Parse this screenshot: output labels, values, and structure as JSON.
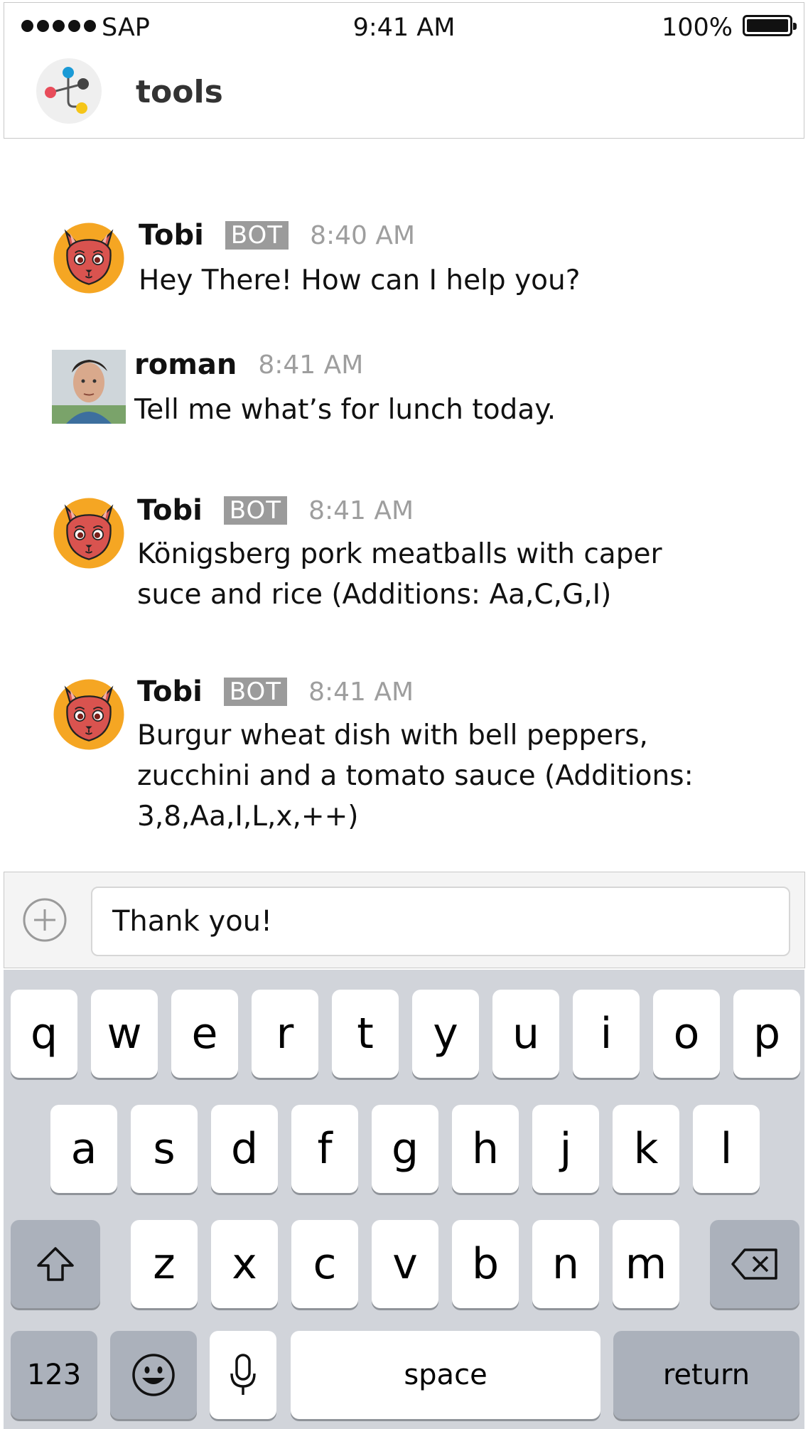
{
  "status_bar": {
    "carrier": "SAP",
    "time": "9:41 AM",
    "battery": "100%"
  },
  "channel": {
    "name": "tools"
  },
  "messages": [
    {
      "author": "Tobi",
      "badge": "BOT",
      "time": "8:40 AM",
      "text": "Hey There! How can I help you?"
    },
    {
      "author": "roman",
      "time": "8:41 AM",
      "text": "Tell me what’s for lunch today."
    },
    {
      "author": "Tobi",
      "badge": "BOT",
      "time": "8:41 AM",
      "text": "Königsberg pork meatballs with caper suce and rice (Additions: Aa,C,G,I)"
    },
    {
      "author": "Tobi",
      "badge": "BOT",
      "time": "8:41 AM",
      "text": "Burgur wheat dish with bell peppers, zucchini and a tomato sauce (Additions: 3,8,Aa,I,L,x,++)"
    }
  ],
  "composer": {
    "value": "Thank you!"
  },
  "keyboard": {
    "row1": [
      "q",
      "w",
      "e",
      "r",
      "t",
      "y",
      "u",
      "i",
      "o",
      "p"
    ],
    "row2": [
      "a",
      "s",
      "d",
      "f",
      "g",
      "h",
      "j",
      "k",
      "l"
    ],
    "row3": [
      "z",
      "x",
      "c",
      "v",
      "b",
      "n",
      "m"
    ],
    "numbers": "123",
    "space": "space",
    "return": "return"
  },
  "icons": {
    "signal": "signal-dots-icon",
    "battery": "battery-icon",
    "logo": "tools-channel-logo",
    "plus": "plus-circle-icon",
    "shift": "shift-icon",
    "delete": "backspace-icon",
    "emoji": "emoji-icon",
    "mic": "microphone-icon"
  },
  "colors": {
    "bot_badge": "#9b9b9b",
    "keyboard_bg": "#d1d4da",
    "avatar_orange": "#f5a623"
  }
}
